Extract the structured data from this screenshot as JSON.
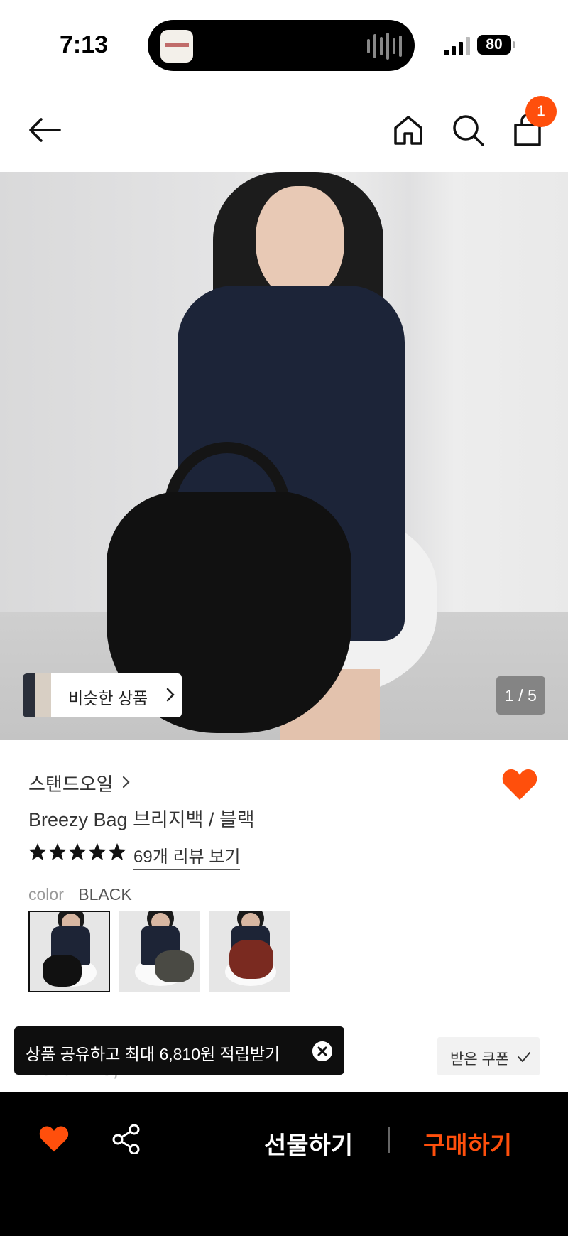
{
  "status_bar": {
    "time": "7:13",
    "battery": "80"
  },
  "header": {
    "cart_count": "1"
  },
  "gallery": {
    "similar_label": "비슷한 상품",
    "page_indicator": "1 / 5"
  },
  "product": {
    "brand": "스탠드오일",
    "title": "Breezy Bag 브리지백 / 블랙",
    "rating_stars": 5,
    "review_link": "69개 리뷰 보기",
    "color_key": "color",
    "color_value": "BLACK",
    "price_peek": "15% 123,"
  },
  "toast": {
    "text": "상품 공유하고 최대 6,810원 적립받기"
  },
  "coupon": {
    "label": "받은 쿠폰"
  },
  "bottom_bar": {
    "gift_label": "선물하기",
    "buy_label": "구매하기"
  },
  "colors": {
    "accent": "#ff4f0c",
    "bar_bg": "#000000"
  },
  "icons": [
    "back-arrow-icon",
    "home-icon",
    "search-icon",
    "shopping-bag-icon",
    "heart-icon",
    "share-icon",
    "chevron-right-icon",
    "close-icon",
    "check-icon",
    "star-icon"
  ]
}
